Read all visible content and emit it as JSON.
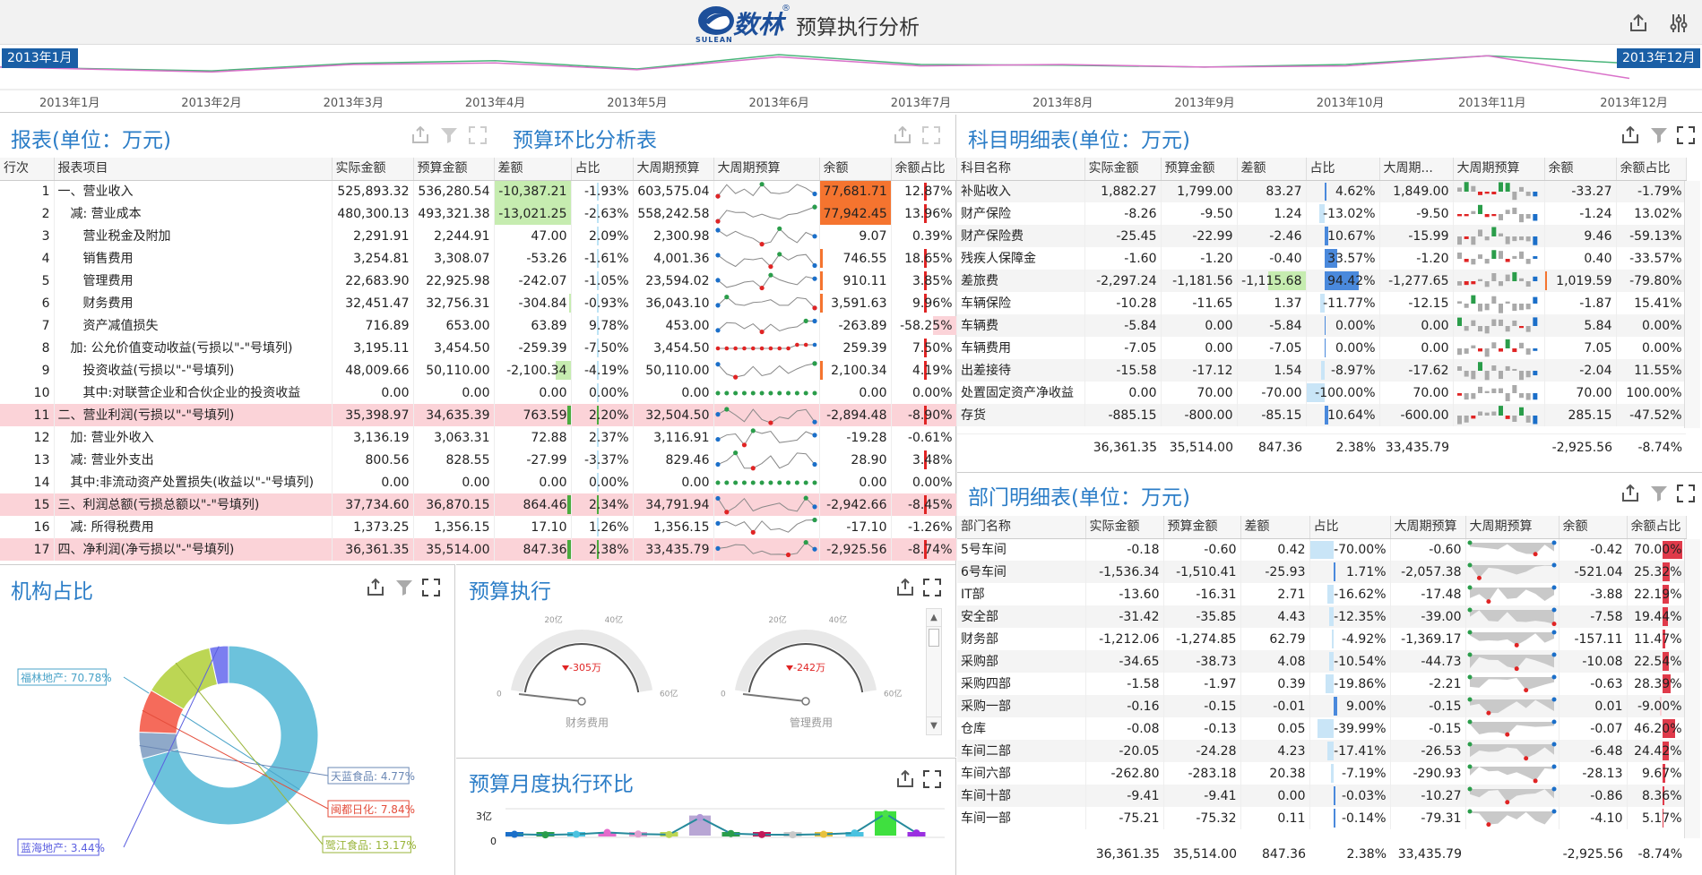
{
  "header": {
    "brand": "数林",
    "reg": "®",
    "subbrand": "SULEAN",
    "title": "预算执行分析"
  },
  "timeline": {
    "start_flag": "2013年1月",
    "end_flag": "2013年12月",
    "months": [
      "2013年1月",
      "2013年2月",
      "2013年3月",
      "2013年4月",
      "2013年5月",
      "2013年6月",
      "2013年7月",
      "2013年8月",
      "2013年9月",
      "2013年10月",
      "2013年11月",
      "2013年12月"
    ],
    "series_actual": [
      0.55,
      0.45,
      0.65,
      0.72,
      0.5,
      0.88,
      0.62,
      0.6,
      0.55,
      0.62,
      0.85,
      0.65
    ],
    "series_budget": [
      0.55,
      0.42,
      0.62,
      0.66,
      0.48,
      0.82,
      0.58,
      0.62,
      0.55,
      0.58,
      0.85,
      0.25
    ],
    "colors": {
      "actual": "#49b57a",
      "budget": "#d971c9"
    }
  },
  "report": {
    "title": "报表(单位：万元)",
    "columns": [
      "行次",
      "报表项目",
      "实际金额",
      "预算金额",
      "差额",
      "占比",
      "大周期预算",
      "大周期预算",
      "余额",
      "余额占比"
    ],
    "rows": [
      {
        "no": "1",
        "name": "一、营业收入",
        "indent": 0,
        "actual": "525,893.32",
        "budget": "536,280.54",
        "diff": "-10,387.21",
        "ratio": "-1.93%",
        "cycle": "603,575.04",
        "balance": "77,681.71",
        "bratio": "12.87%",
        "hl": false,
        "dneg": 1,
        "borg": 1,
        "bratio_v": 0.2
      },
      {
        "no": "2",
        "name": "减: 营业成本",
        "indent": 1,
        "actual": "480,300.13",
        "budget": "493,321.38",
        "diff": "-13,021.25",
        "ratio": "-2.63%",
        "cycle": "558,242.58",
        "balance": "77,942.45",
        "bratio": "13.96%",
        "hl": false,
        "dneg": 1,
        "borg": 1,
        "bratio_v": 0.22
      },
      {
        "no": "3",
        "name": "营业税金及附加",
        "indent": 2,
        "actual": "2,291.91",
        "budget": "2,244.91",
        "diff": "47.00",
        "ratio": "2.09%",
        "cycle": "2,300.98",
        "balance": "9.07",
        "bratio": "0.39%",
        "hl": false,
        "dneg": 0,
        "borg": 0,
        "bratio_v": 0
      },
      {
        "no": "4",
        "name": "销售费用",
        "indent": 2,
        "actual": "3,254.81",
        "budget": "3,308.07",
        "diff": "-53.26",
        "ratio": "-1.61%",
        "cycle": "4,001.36",
        "balance": "746.55",
        "bratio": "18.65%",
        "hl": false,
        "dneg": 0,
        "borg": 0.03,
        "bratio_v": 0.3
      },
      {
        "no": "5",
        "name": "管理费用",
        "indent": 2,
        "actual": "22,683.90",
        "budget": "22,925.98",
        "diff": "-242.07",
        "ratio": "-1.05%",
        "cycle": "23,594.02",
        "balance": "910.11",
        "bratio": "3.85%",
        "hl": false,
        "dneg": 0,
        "borg": 0.03,
        "bratio_v": 0.06
      },
      {
        "no": "6",
        "name": "财务费用",
        "indent": 2,
        "actual": "32,451.47",
        "budget": "32,756.31",
        "diff": "-304.84",
        "ratio": "-0.93%",
        "cycle": "36,043.10",
        "balance": "3,591.63",
        "bratio": "9.96%",
        "hl": false,
        "dneg": 0.02,
        "borg": 0.05,
        "bratio_v": 0.15
      },
      {
        "no": "7",
        "name": "资产减值损失",
        "indent": 2,
        "actual": "716.89",
        "budget": "653.00",
        "diff": "63.89",
        "ratio": "9.78%",
        "cycle": "453.00",
        "balance": "-263.89",
        "bratio": "-58.25%",
        "hl": false,
        "dneg": 0,
        "borg": 0,
        "bratio_v": -0.9
      },
      {
        "no": "8",
        "name": "加: 公允价值变动收益(亏损以\"-\"号填列)",
        "indent": 1,
        "actual": "3,195.11",
        "budget": "3,454.50",
        "diff": "-259.39",
        "ratio": "-7.50%",
        "cycle": "3,454.50",
        "balance": "259.39",
        "bratio": "7.50%",
        "hl": false,
        "dneg": 0,
        "borg": 0,
        "bratio_v": 0.12
      },
      {
        "no": "9",
        "name": "投资收益(亏损以\"-\"号填列)",
        "indent": 2,
        "actual": "48,009.66",
        "budget": "50,110.00",
        "diff": "-2,100.34",
        "ratio": "-4.19%",
        "cycle": "50,110.00",
        "balance": "2,100.34",
        "bratio": "4.19%",
        "hl": false,
        "dneg": 0.2,
        "borg": 0.03,
        "bratio_v": 0.07
      },
      {
        "no": "10",
        "name": "其中:对联营企业和合伙企业的投资收益",
        "indent": 2,
        "actual": "0.00",
        "budget": "0.00",
        "diff": "0.00",
        "ratio": "0.00%",
        "cycle": "0.00",
        "balance": "0.00",
        "bratio": "0.00%",
        "hl": false,
        "dneg": 0,
        "borg": 0,
        "bratio_v": 0
      },
      {
        "no": "11",
        "name": "二、营业利润(亏损以\"-\"号填列)",
        "indent": 0,
        "actual": "35,398.97",
        "budget": "34,635.39",
        "diff": "763.59",
        "ratio": "2.20%",
        "cycle": "32,504.50",
        "balance": "-2,894.48",
        "bratio": "-8.90%",
        "hl": true,
        "dneg": 0,
        "borg": 0,
        "bratio_v": -0.14
      },
      {
        "no": "12",
        "name": "加: 营业外收入",
        "indent": 1,
        "actual": "3,136.19",
        "budget": "3,063.31",
        "diff": "72.88",
        "ratio": "2.37%",
        "cycle": "3,116.91",
        "balance": "-19.28",
        "bratio": "-0.61%",
        "hl": false,
        "dneg": 0,
        "borg": 0,
        "bratio_v": 0
      },
      {
        "no": "13",
        "name": "减: 营业外支出",
        "indent": 1,
        "actual": "800.56",
        "budget": "828.55",
        "diff": "-27.99",
        "ratio": "-3.37%",
        "cycle": "829.46",
        "balance": "28.90",
        "bratio": "3.48%",
        "hl": false,
        "dneg": 0,
        "borg": 0,
        "bratio_v": 0.06
      },
      {
        "no": "14",
        "name": "其中:非流动资产处置损失(收益以\"-\"号填列)",
        "indent": 1,
        "actual": "0.00",
        "budget": "0.00",
        "diff": "0.00",
        "ratio": "0.00%",
        "cycle": "0.00",
        "balance": "0.00",
        "bratio": "0.00%",
        "hl": false,
        "dneg": 0,
        "borg": 0,
        "bratio_v": 0
      },
      {
        "no": "15",
        "name": "三、利润总额(亏损总额以\"-\"号填列)",
        "indent": 0,
        "actual": "37,734.60",
        "budget": "36,870.15",
        "diff": "864.46",
        "ratio": "2.34%",
        "cycle": "34,791.94",
        "balance": "-2,942.66",
        "bratio": "-8.45%",
        "hl": true,
        "dneg": 0,
        "borg": 0,
        "bratio_v": -0.13
      },
      {
        "no": "16",
        "name": "减: 所得税费用",
        "indent": 1,
        "actual": "1,373.25",
        "budget": "1,356.15",
        "diff": "17.10",
        "ratio": "1.26%",
        "cycle": "1,356.15",
        "balance": "-17.10",
        "bratio": "-1.26%",
        "hl": false,
        "dneg": 0,
        "borg": 0,
        "bratio_v": 0
      },
      {
        "no": "17",
        "name": "四、净利润(净亏损以\"-\"号填列)",
        "indent": 0,
        "actual": "36,361.35",
        "budget": "35,514.00",
        "diff": "847.36",
        "ratio": "2.38%",
        "cycle": "33,435.79",
        "balance": "-2,925.56",
        "bratio": "-8.74%",
        "hl": true,
        "dneg": 0,
        "borg": 0,
        "bratio_v": -0.13
      }
    ]
  },
  "ring": {
    "title": "预算环比分析表"
  },
  "subject": {
    "title": "科目明细表(单位：万元)",
    "columns": [
      "科目名称",
      "实际金额",
      "预算金额",
      "差额",
      "占比",
      "大周期...",
      "大周期预算",
      "余额",
      "余额占比"
    ],
    "rows": [
      {
        "name": "补贴收入",
        "actual": "1,882.27",
        "budget": "1,799.00",
        "diff": "83.27",
        "ratio": "4.62%",
        "cycle": "1,849.00",
        "balance": "-33.27",
        "bratio": "-1.79%",
        "rv": 0.05
      },
      {
        "name": "财产保险",
        "actual": "-8.26",
        "budget": "-9.50",
        "diff": "1.24",
        "ratio": "-13.02%",
        "cycle": "-9.50",
        "balance": "-1.24",
        "bratio": "13.02%",
        "rv": -0.13
      },
      {
        "name": "财产保险费",
        "actual": "-25.45",
        "budget": "-22.99",
        "diff": "-2.46",
        "ratio": "10.67%",
        "cycle": "-15.99",
        "balance": "9.46",
        "bratio": "-59.13%",
        "rv": 0.11
      },
      {
        "name": "残疾人保障金",
        "actual": "-1.60",
        "budget": "-1.20",
        "diff": "-0.40",
        "ratio": "33.57%",
        "cycle": "-1.20",
        "balance": "0.40",
        "bratio": "-33.57%",
        "rv": 0.34
      },
      {
        "name": "差旅费",
        "actual": "-2,297.24",
        "budget": "-1,181.56",
        "diff": "-1,115.68",
        "ratio": "94.42%",
        "cycle": "-1,277.65",
        "balance": "1,019.59",
        "bratio": "-79.80%",
        "rv": 0.94
      },
      {
        "name": "车辆保险",
        "actual": "-10.28",
        "budget": "-11.65",
        "diff": "1.37",
        "ratio": "-11.77%",
        "cycle": "-12.15",
        "balance": "-1.87",
        "bratio": "15.41%",
        "rv": -0.12
      },
      {
        "name": "车辆费",
        "actual": "-5.84",
        "budget": "0.00",
        "diff": "-5.84",
        "ratio": "0.00%",
        "cycle": "0.00",
        "balance": "5.84",
        "bratio": "0.00%",
        "rv": 0
      },
      {
        "name": "车辆费用",
        "actual": "-7.05",
        "budget": "0.00",
        "diff": "-7.05",
        "ratio": "0.00%",
        "cycle": "0.00",
        "balance": "7.05",
        "bratio": "0.00%",
        "rv": 0
      },
      {
        "name": "出差接待",
        "actual": "-15.58",
        "budget": "-17.12",
        "diff": "1.54",
        "ratio": "-8.97%",
        "cycle": "-17.62",
        "balance": "-2.04",
        "bratio": "11.55%",
        "rv": -0.09
      },
      {
        "name": "处置固定资产净收益",
        "actual": "0.00",
        "budget": "70.00",
        "diff": "-70.00",
        "ratio": "-100.00%",
        "cycle": "70.00",
        "balance": "70.00",
        "bratio": "100.00%",
        "rv": -1
      },
      {
        "name": "存货",
        "actual": "-885.15",
        "budget": "-800.00",
        "diff": "-85.15",
        "ratio": "10.64%",
        "cycle": "-600.00",
        "balance": "285.15",
        "bratio": "-47.52%",
        "rv": 0.11
      }
    ],
    "total": {
      "actual": "36,361.35",
      "budget": "35,514.00",
      "diff": "847.36",
      "ratio": "2.38%",
      "cycle": "33,435.79",
      "balance": "-2,925.56",
      "bratio": "-8.74%"
    }
  },
  "org": {
    "title": "机构占比",
    "slices": [
      {
        "name": "福林地产",
        "pct": 70.78,
        "label": "福林地产: 70.78%",
        "color": "#6cc2dc"
      },
      {
        "name": "天蓝食品",
        "pct": 4.77,
        "label": "天蓝食品: 4.77%",
        "color": "#8fa9c9"
      },
      {
        "name": "闽都日化",
        "pct": 7.84,
        "label": "闽都日化: 7.84%",
        "color": "#f56b5b"
      },
      {
        "name": "鹭江食品",
        "pct": 13.17,
        "label": "鹭江食品: 13.17%",
        "color": "#bcd654"
      },
      {
        "name": "蓝海地产",
        "pct": 3.44,
        "label": "蓝海地产: 3.44%",
        "color": "#7b7ff0"
      }
    ]
  },
  "exec": {
    "title": "预算执行",
    "gauges": [
      {
        "name": "财务费用",
        "value": "-305万",
        "ticks": [
          "0",
          "20亿",
          "40亿",
          "60亿"
        ]
      },
      {
        "name": "管理费用",
        "value": "-242万",
        "ticks": [
          "0",
          "20亿",
          "40亿",
          "60亿"
        ]
      }
    ]
  },
  "monthly": {
    "title": "预算月度执行环比",
    "ytop": "3亿",
    "ybot": "0"
  },
  "dept": {
    "title": "部门明细表(单位：万元)",
    "columns": [
      "部门名称",
      "实际金额",
      "预算金额",
      "差额",
      "占比",
      "大周期预算",
      "大周期预算",
      "余额",
      "余额占比"
    ],
    "rows": [
      {
        "name": "5号车间",
        "actual": "-0.18",
        "budget": "-0.60",
        "diff": "0.42",
        "ratio": "-70.00%",
        "cycle": "-0.60",
        "balance": "-0.42",
        "bratio": "70.00%",
        "rv": -0.7,
        "bv": 0.7
      },
      {
        "name": "6号车间",
        "actual": "-1,536.34",
        "budget": "-1,510.41",
        "diff": "-25.93",
        "ratio": "1.71%",
        "cycle": "-2,057.38",
        "balance": "-521.04",
        "bratio": "25.32%",
        "rv": 0.02,
        "bv": 0.25
      },
      {
        "name": "IT部",
        "actual": "-13.60",
        "budget": "-16.31",
        "diff": "2.71",
        "ratio": "-16.62%",
        "cycle": "-17.48",
        "balance": "-3.88",
        "bratio": "22.19%",
        "rv": -0.17,
        "bv": 0.22
      },
      {
        "name": "安全部",
        "actual": "-31.42",
        "budget": "-35.85",
        "diff": "4.43",
        "ratio": "-12.35%",
        "cycle": "-39.00",
        "balance": "-7.58",
        "bratio": "19.44%",
        "rv": -0.12,
        "bv": 0.19
      },
      {
        "name": "财务部",
        "actual": "-1,212.06",
        "budget": "-1,274.85",
        "diff": "62.79",
        "ratio": "-4.92%",
        "cycle": "-1,369.17",
        "balance": "-157.11",
        "bratio": "11.47%",
        "rv": -0.05,
        "bv": 0.11
      },
      {
        "name": "采购部",
        "actual": "-34.65",
        "budget": "-38.73",
        "diff": "4.08",
        "ratio": "-10.54%",
        "cycle": "-44.73",
        "balance": "-10.08",
        "bratio": "22.54%",
        "rv": -0.11,
        "bv": 0.23
      },
      {
        "name": "采购四部",
        "actual": "-1.58",
        "budget": "-1.97",
        "diff": "0.39",
        "ratio": "-19.86%",
        "cycle": "-2.21",
        "balance": "-0.63",
        "bratio": "28.39%",
        "rv": -0.2,
        "bv": 0.28
      },
      {
        "name": "采购一部",
        "actual": "-0.16",
        "budget": "-0.15",
        "diff": "-0.01",
        "ratio": "9.00%",
        "cycle": "-0.15",
        "balance": "0.01",
        "bratio": "-9.00%",
        "rv": 0.09,
        "bv": -0.09
      },
      {
        "name": "仓库",
        "actual": "-0.08",
        "budget": "-0.13",
        "diff": "0.05",
        "ratio": "-39.99%",
        "cycle": "-0.15",
        "balance": "-0.07",
        "bratio": "46.20%",
        "rv": -0.4,
        "bv": 0.46
      },
      {
        "name": "车间二部",
        "actual": "-20.05",
        "budget": "-24.28",
        "diff": "4.23",
        "ratio": "-17.41%",
        "cycle": "-26.53",
        "balance": "-6.48",
        "bratio": "24.42%",
        "rv": -0.17,
        "bv": 0.24
      },
      {
        "name": "车间六部",
        "actual": "-262.80",
        "budget": "-283.18",
        "diff": "20.38",
        "ratio": "-7.19%",
        "cycle": "-290.93",
        "balance": "-28.13",
        "bratio": "9.67%",
        "rv": -0.07,
        "bv": 0.1
      },
      {
        "name": "车间十部",
        "actual": "-9.41",
        "budget": "-9.41",
        "diff": "0.00",
        "ratio": "-0.03%",
        "cycle": "-10.27",
        "balance": "-0.86",
        "bratio": "8.36%",
        "rv": 0,
        "bv": 0.08
      },
      {
        "name": "车间一部",
        "actual": "-75.21",
        "budget": "-75.32",
        "diff": "0.11",
        "ratio": "-0.14%",
        "cycle": "-79.31",
        "balance": "-4.10",
        "bratio": "5.17%",
        "rv": 0,
        "bv": 0.05
      }
    ],
    "total": {
      "actual": "36,361.35",
      "budget": "35,514.00",
      "diff": "847.36",
      "ratio": "2.38%",
      "cycle": "33,435.79",
      "balance": "-2,925.56",
      "bratio": "-8.74%"
    }
  }
}
